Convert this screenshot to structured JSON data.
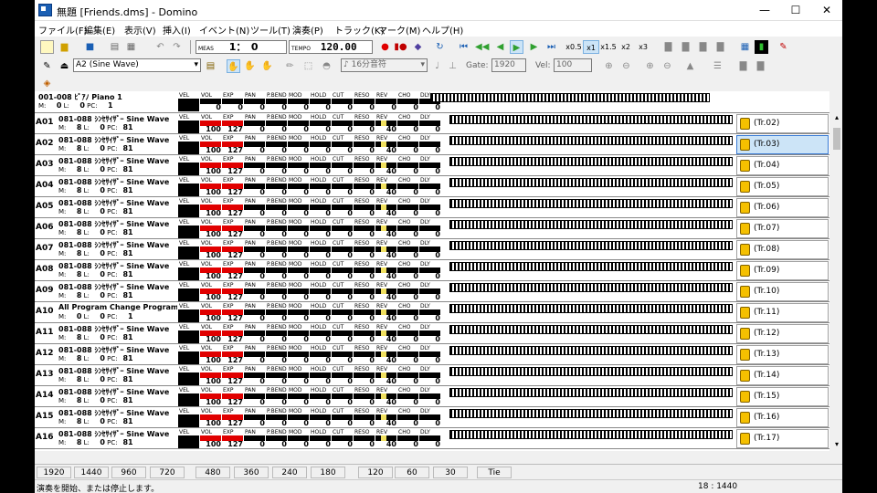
{
  "window": {
    "title": "無題 [Friends.dms] - Domino",
    "min": "—",
    "max": "☐",
    "close": "✕"
  },
  "menu": [
    "ファイル(F)",
    "編集(E)",
    "表示(V)",
    "挿入(I)",
    "イベント(N)",
    "ツール(T)",
    "演奏(P)",
    "トラック(K)",
    "マーク(M)",
    "ヘルプ(H)"
  ],
  "toolbar": {
    "meas_label": "MEAS",
    "meas_value": "1：　0",
    "tempo_label": "TEMPO",
    "tempo_value": "120.00",
    "speeds": [
      "x0.5",
      "x1",
      "x1.5",
      "x2",
      "x3"
    ],
    "instrument": "A2  (Sine Wave)",
    "note_len": "16分音符",
    "gate_label": "Gate:",
    "gate_value": "1920",
    "vel_label": "Vel:",
    "vel_value": "100"
  },
  "master": {
    "name": "001-008 ﾋﾟｱﾉ Piano 1",
    "m": "0",
    "l": "0",
    "pc": "1"
  },
  "ctl_labels": [
    "VEL",
    "VOL",
    "EXP",
    "PAN",
    "P.BEND",
    "MOD",
    "HOLD",
    "CUT",
    "RESO",
    "REV",
    "CHO",
    "DLY"
  ],
  "master_values": [
    "",
    "0",
    "0",
    "0",
    "0",
    "0",
    "0",
    "0",
    "0",
    "0",
    "0",
    "0"
  ],
  "tracks": [
    {
      "id": "A01",
      "name": "081-088 ｼﾝｾｻｲｻﾞｰ Sine Wave",
      "m": "8",
      "l": "0",
      "pc": "81",
      "out": "(Tr.02)"
    },
    {
      "id": "A02",
      "name": "081-088 ｼﾝｾｻｲｻﾞｰ Sine Wave",
      "m": "8",
      "l": "0",
      "pc": "81",
      "out": "(Tr.03)"
    },
    {
      "id": "A03",
      "name": "081-088 ｼﾝｾｻｲｻﾞｰ Sine Wave",
      "m": "8",
      "l": "0",
      "pc": "81",
      "out": "(Tr.04)"
    },
    {
      "id": "A04",
      "name": "081-088 ｼﾝｾｻｲｻﾞｰ Sine Wave",
      "m": "8",
      "l": "0",
      "pc": "81",
      "out": "(Tr.05)"
    },
    {
      "id": "A05",
      "name": "081-088 ｼﾝｾｻｲｻﾞｰ Sine Wave",
      "m": "8",
      "l": "0",
      "pc": "81",
      "out": "(Tr.06)"
    },
    {
      "id": "A06",
      "name": "081-088 ｼﾝｾｻｲｻﾞｰ Sine Wave",
      "m": "8",
      "l": "0",
      "pc": "81",
      "out": "(Tr.07)"
    },
    {
      "id": "A07",
      "name": "081-088 ｼﾝｾｻｲｻﾞｰ Sine Wave",
      "m": "8",
      "l": "0",
      "pc": "81",
      "out": "(Tr.08)"
    },
    {
      "id": "A08",
      "name": "081-088 ｼﾝｾｻｲｻﾞｰ Sine Wave",
      "m": "8",
      "l": "0",
      "pc": "81",
      "out": "(Tr.09)"
    },
    {
      "id": "A09",
      "name": "081-088 ｼﾝｾｻｲｻﾞｰ Sine Wave",
      "m": "8",
      "l": "0",
      "pc": "81",
      "out": "(Tr.10)"
    },
    {
      "id": "A10",
      "name": "All Program Change Program C",
      "m": "0",
      "l": "0",
      "pc": "1",
      "out": "(Tr.11)"
    },
    {
      "id": "A11",
      "name": "081-088 ｼﾝｾｻｲｻﾞｰ Sine Wave",
      "m": "8",
      "l": "0",
      "pc": "81",
      "out": "(Tr.12)"
    },
    {
      "id": "A12",
      "name": "081-088 ｼﾝｾｻｲｻﾞｰ Sine Wave",
      "m": "8",
      "l": "0",
      "pc": "81",
      "out": "(Tr.13)"
    },
    {
      "id": "A13",
      "name": "081-088 ｼﾝｾｻｲｻﾞｰ Sine Wave",
      "m": "8",
      "l": "0",
      "pc": "81",
      "out": "(Tr.14)"
    },
    {
      "id": "A14",
      "name": "081-088 ｼﾝｾｻｲｻﾞｰ Sine Wave",
      "m": "8",
      "l": "0",
      "pc": "81",
      "out": "(Tr.15)"
    },
    {
      "id": "A15",
      "name": "081-088 ｼﾝｾｻｲｻﾞｰ Sine Wave",
      "m": "8",
      "l": "0",
      "pc": "81",
      "out": "(Tr.16)"
    },
    {
      "id": "A16",
      "name": "081-088 ｼﾝｾｻｲｻﾞｰ Sine Wave",
      "m": "8",
      "l": "0",
      "pc": "81",
      "out": "(Tr.17)"
    }
  ],
  "track_values": [
    "",
    "100",
    "127",
    "0",
    "0",
    "0",
    "0",
    "0",
    "0",
    "40",
    "0",
    "0"
  ],
  "selected_out": 1,
  "bottom_ticks": [
    "1920",
    "1440",
    "960",
    "720",
    "480",
    "360",
    "240",
    "180",
    "120",
    "60",
    "30",
    "Tie"
  ],
  "status": {
    "message": "演奏を開始、または停止します。",
    "position": "18 : 1440"
  },
  "colors": {
    "vol_bar": "#e00000",
    "rev_bar": "#f0e060",
    "selected": "#cce4f7"
  }
}
